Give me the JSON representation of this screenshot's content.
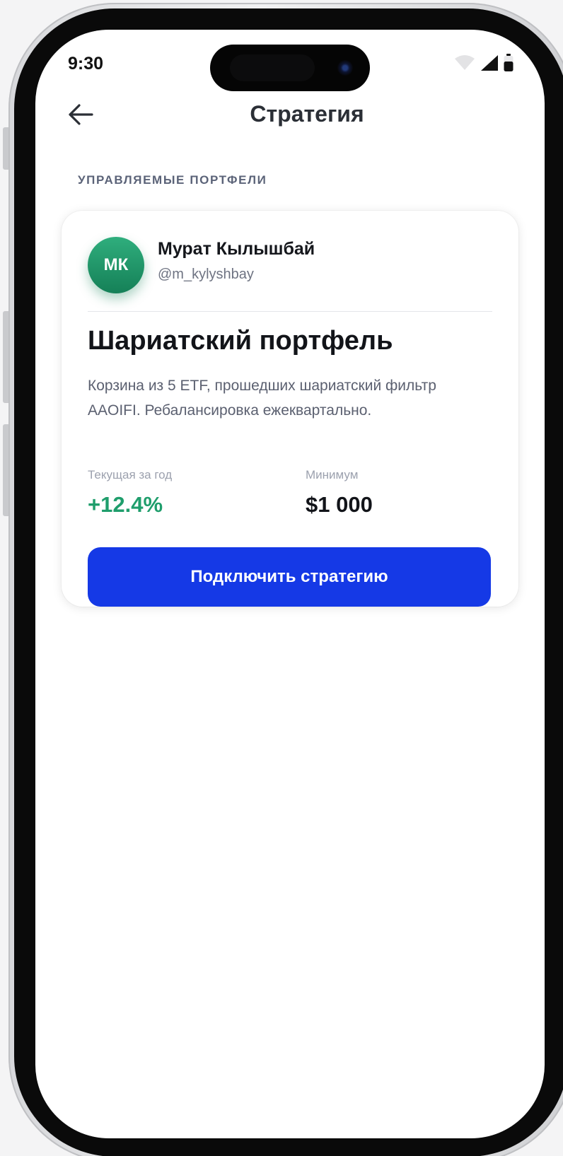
{
  "status_bar": {
    "time": "9:30"
  },
  "header": {
    "title": "Стратегия",
    "back_icon": "arrow-left-icon"
  },
  "section": {
    "label": "УПРАВЛЯЕМЫЕ ПОРТФЕЛИ"
  },
  "card": {
    "author": {
      "initials": "МК",
      "name": "Мурат Кылышбай",
      "handle": "@m_kylyshbay"
    },
    "portfolio_title": "Шариатский портфель",
    "description": "Корзина из 5 ETF, прошедших шариатский фильтр AAOIFI. Ребалансировка ежеквартально.",
    "stats": [
      {
        "label": "Текущая за год",
        "value": "+12.4%",
        "color": "#1f9e6c"
      },
      {
        "label": "Минимум",
        "value": "$1 000",
        "color": "#121419"
      }
    ],
    "cta_label": "Подключить стратегию"
  },
  "colors": {
    "accent": "#1539e6",
    "positive": "#1f9e6c",
    "avatar": "#1e9066"
  }
}
